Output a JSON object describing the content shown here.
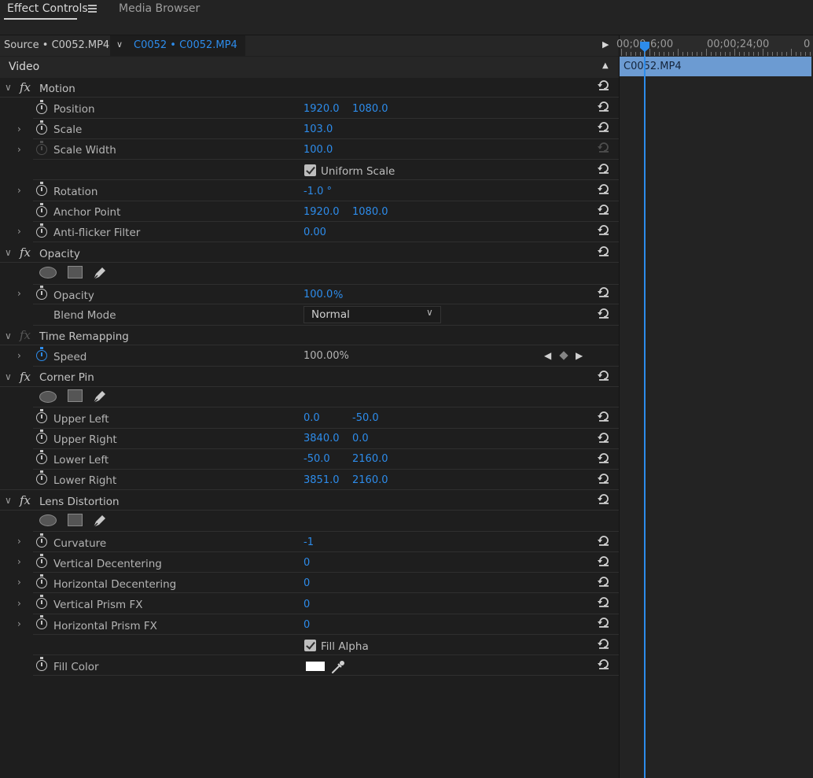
{
  "tabs": {
    "effect_controls": "Effect Controls",
    "media_browser": "Media Browser"
  },
  "source": {
    "label": "Source • C0052.MP4",
    "clip": "C0052 • C0052.MP4"
  },
  "section": {
    "title": "Video"
  },
  "motion": {
    "title": "Motion",
    "position": {
      "label": "Position",
      "x": "1920.0",
      "y": "1080.0"
    },
    "scale": {
      "label": "Scale",
      "value": "103.0"
    },
    "scale_width": {
      "label": "Scale Width",
      "value": "100.0"
    },
    "uniform_scale": {
      "label": "Uniform Scale",
      "checked": true
    },
    "rotation": {
      "label": "Rotation",
      "value": "-1.0 °"
    },
    "anchor_point": {
      "label": "Anchor Point",
      "x": "1920.0",
      "y": "1080.0"
    },
    "anti_flicker": {
      "label": "Anti-flicker Filter",
      "value": "0.00"
    }
  },
  "opacity": {
    "title": "Opacity",
    "opacity": {
      "label": "Opacity",
      "value": "100.0",
      "unit": "%"
    },
    "blend_mode": {
      "label": "Blend Mode",
      "value": "Normal"
    }
  },
  "time_remapping": {
    "title": "Time Remapping",
    "speed": {
      "label": "Speed",
      "value": "100.00%"
    }
  },
  "corner_pin": {
    "title": "Corner Pin",
    "upper_left": {
      "label": "Upper Left",
      "x": "0.0",
      "y": "-50.0"
    },
    "upper_right": {
      "label": "Upper Right",
      "x": "3840.0",
      "y": "0.0"
    },
    "lower_left": {
      "label": "Lower Left",
      "x": "-50.0",
      "y": "2160.0"
    },
    "lower_right": {
      "label": "Lower Right",
      "x": "3851.0",
      "y": "2160.0"
    }
  },
  "lens_distortion": {
    "title": "Lens Distortion",
    "curvature": {
      "label": "Curvature",
      "value": "-1"
    },
    "vertical_decentering": {
      "label": "Vertical Decentering",
      "value": "0"
    },
    "horizontal_decentering": {
      "label": "Horizontal Decentering",
      "value": "0"
    },
    "vertical_prism": {
      "label": "Vertical Prism FX",
      "value": "0"
    },
    "horizontal_prism": {
      "label": "Horizontal Prism FX",
      "value": "0"
    },
    "fill_alpha": {
      "label": "Fill Alpha",
      "checked": true
    },
    "fill_color": {
      "label": "Fill Color",
      "color": "#ffffff"
    }
  },
  "timeline": {
    "tc_start": "00;00",
    "tc_mid": "6;00",
    "tc_2": "00;00;24;00",
    "tc_3": "0",
    "clip_name": "C0052.MP4"
  },
  "colors": {
    "accent": "#2d8ceb",
    "clip_bar": "#6c9bd2",
    "panel_bg": "#1e1e1e"
  }
}
